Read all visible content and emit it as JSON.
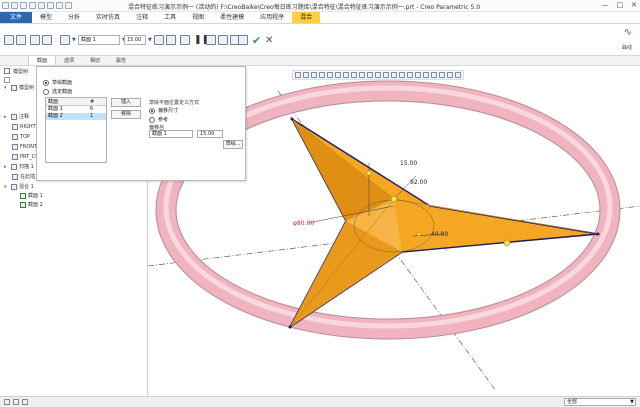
{
  "window": {
    "title": "混合特征练习演示示例一 (活动的) F:\\CreoBaike\\Creo每日练习题库\\混合特征\\混合特征练习演示示例一.prt - Creo Parametric 5.0",
    "controls": [
      "—",
      "□",
      "✕"
    ]
  },
  "ribbon": {
    "tabs": [
      {
        "label": "文件",
        "kind": "file"
      },
      {
        "label": "模型",
        "kind": "normal"
      },
      {
        "label": "分析",
        "kind": "normal"
      },
      {
        "label": "实时仿真",
        "kind": "normal"
      },
      {
        "label": "注释",
        "kind": "normal"
      },
      {
        "label": "工具",
        "kind": "normal"
      },
      {
        "label": "视图",
        "kind": "normal"
      },
      {
        "label": "柔性建模",
        "kind": "normal"
      },
      {
        "label": "应用程序",
        "kind": "normal"
      },
      {
        "label": "混合",
        "kind": "active"
      }
    ]
  },
  "toolbar": {
    "section_select_value": "截面 1",
    "depth_value": "15.00",
    "options_label": "选项",
    "tangency_label": "相切",
    "right_panel_label": "曲线"
  },
  "subtabs": [
    "截面",
    "选项",
    "相切",
    "属性"
  ],
  "model_tree": {
    "header_label": "模型树",
    "rows": [
      {
        "label": "模型树",
        "icon": "tree"
      },
      {
        "label": "注释",
        "icon": "note"
      },
      {
        "label": "RIGHT",
        "icon": "plane"
      },
      {
        "label": "TOP",
        "icon": "plane"
      },
      {
        "label": "FRONT",
        "icon": "plane"
      },
      {
        "label": "PRT_CSYS",
        "icon": "csys"
      },
      {
        "label": "扫描 1",
        "icon": "feature"
      },
      {
        "label": "在此插入",
        "icon": "insert"
      },
      {
        "label": "混合 1",
        "icon": "feature"
      },
      {
        "label": "截面 1",
        "icon": "sketch"
      },
      {
        "label": "截面 2",
        "icon": "sketch"
      }
    ]
  },
  "sections_panel": {
    "radio_sketched": "草绘截面",
    "radio_selected": "选定截面",
    "table_header_section": "截面",
    "table_header_count": "#",
    "rows": [
      {
        "name": "截面 1",
        "count": "6"
      },
      {
        "name": "截面 2",
        "count": "1"
      }
    ],
    "insert_button": "插入",
    "remove_button": "移除",
    "placement_label": "草绘平面位置定义方式",
    "radio_offset": "偏移尺寸",
    "radio_reference": "参考",
    "offset_from_label": "偏移自",
    "offset_ref_value": "截面 1",
    "offset_value": "15.00",
    "sketch_button": "草绘..."
  },
  "graphics": {
    "dim_height": "15.00",
    "dim_angle": "92.00",
    "dim_diameter": "φ80.00",
    "dim_length": "40.00"
  },
  "statusbar": {
    "filter_value": "全部"
  },
  "colors": {
    "ring": "#f0b4c0",
    "star_fill": "#f5a623",
    "star_edge": "#1c1c5e",
    "accent_tab": "#ffcf40",
    "file_tab": "#2f66b0"
  }
}
